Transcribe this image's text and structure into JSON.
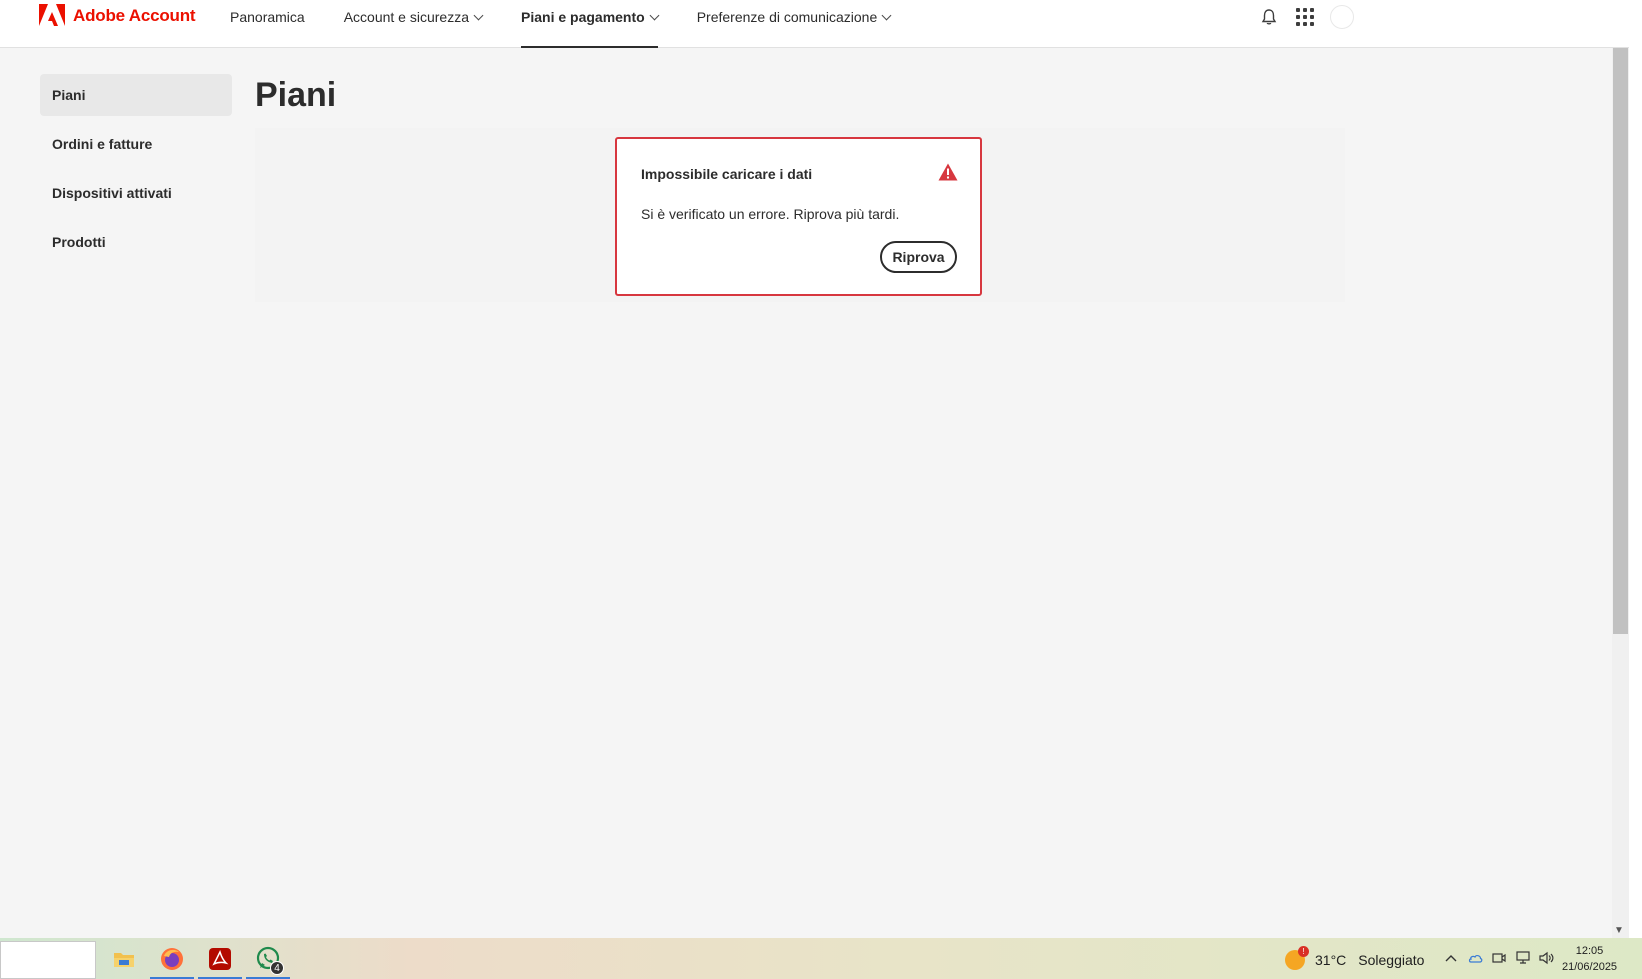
{
  "header": {
    "brand": "Adobe Account",
    "nav": [
      {
        "label": "Panoramica",
        "has_dropdown": false
      },
      {
        "label": "Account e sicurezza",
        "has_dropdown": true
      },
      {
        "label": "Piani e pagamento",
        "has_dropdown": true,
        "active": true
      },
      {
        "label": "Preferenze di comunicazione",
        "has_dropdown": true
      }
    ],
    "icons": [
      "bell-icon",
      "apps-grid-icon",
      "avatar"
    ]
  },
  "sidebar": {
    "items": [
      {
        "label": "Piani",
        "active": true
      },
      {
        "label": "Ordini e fatture"
      },
      {
        "label": "Dispositivi attivati"
      },
      {
        "label": "Prodotti"
      }
    ]
  },
  "main": {
    "title": "Piani",
    "alert": {
      "title": "Impossibile caricare i dati",
      "message": "Si è verificato un errore. Riprova più tardi.",
      "button": "Riprova",
      "icon": "warning-icon"
    }
  },
  "taskbar": {
    "apps": [
      "file-explorer-icon",
      "firefox-icon",
      "acrobat-icon",
      "whatsapp-icon"
    ],
    "whatsapp_badge": "4",
    "weather": {
      "temp": "31°C",
      "condition": "Soleggiato",
      "alert": "!"
    },
    "time": "12:05",
    "date": "21/06/2025"
  },
  "colors": {
    "brand": "#eb1000",
    "alert_border": "#d7373f",
    "warning": "#d7373f"
  }
}
